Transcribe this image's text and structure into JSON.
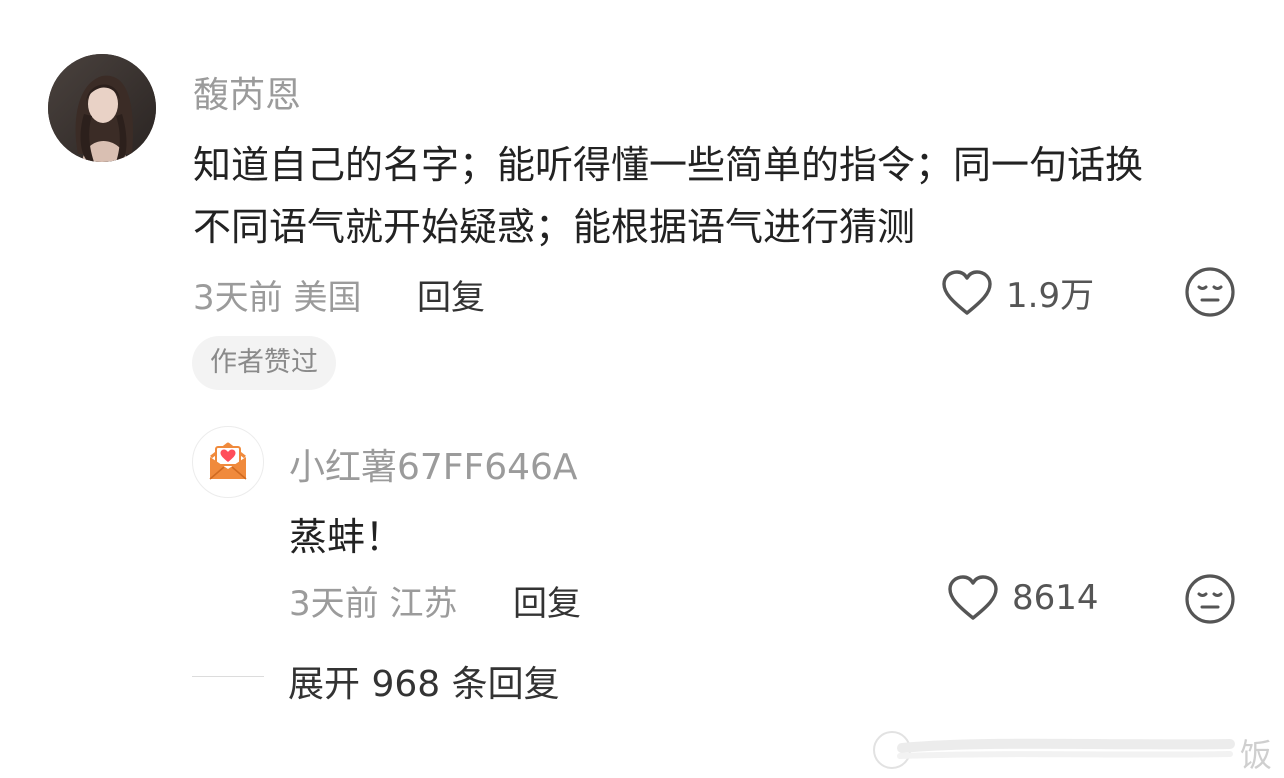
{
  "comment": {
    "username": "馥芮恩",
    "text_line1": "知道自己的名字；能听得懂一些简单的指令；同一句话换",
    "text_line2": "不同语气就开始疑惑；能根据语气进行猜测",
    "meta": "3天前 美国",
    "reply_label": "回复",
    "like_count": "1.9万",
    "badge": "作者赞过"
  },
  "sub_comment": {
    "username": "小红薯67FF646A",
    "text": "蒸蚌！",
    "meta": "3天前 江苏",
    "reply_label": "回复",
    "like_count": "8614"
  },
  "expand": {
    "label": "展开 968 条回复"
  },
  "watermark": {
    "text": "饭"
  },
  "icons": {
    "like": "heart-outline-icon",
    "dislike": "meh-face-icon",
    "sub_avatar": "envelope-heart-icon"
  },
  "colors": {
    "username": "#9b9b9b",
    "text": "#222222",
    "meta": "#9b9b9b",
    "badge_bg": "#f3f3f3",
    "avatar_envelope": "#f08a3c",
    "avatar_heart": "#ff4d5a"
  }
}
